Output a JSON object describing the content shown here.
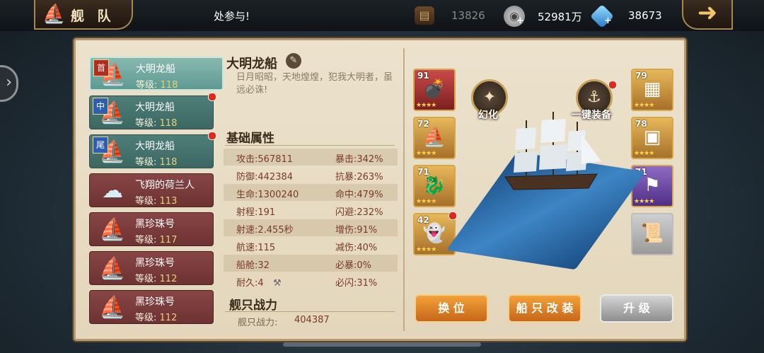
{
  "header": {
    "title": "舰 队",
    "notice": "处参与!",
    "resources": [
      {
        "icon": "coin-chest-icon",
        "value": "13826"
      },
      {
        "icon": "silver-coin-icon",
        "value": "52981万"
      },
      {
        "icon": "diamond-icon",
        "value": "38673"
      }
    ]
  },
  "fleet": [
    {
      "badge": "首",
      "name": "大明龙船",
      "level_label": "等级:",
      "level": "118",
      "style": "selected",
      "dot": false
    },
    {
      "badge": "中",
      "name": "大明龙船",
      "level_label": "等级:",
      "level": "118",
      "style": "green",
      "dot": true
    },
    {
      "badge": "尾",
      "name": "大明龙船",
      "level_label": "等级:",
      "level": "118",
      "style": "green",
      "dot": true
    },
    {
      "badge": "",
      "name": "飞翔的荷兰人",
      "level_label": "等级:",
      "level": "113",
      "style": "red",
      "dot": false
    },
    {
      "badge": "",
      "name": "黑珍珠号",
      "level_label": "等级:",
      "level": "117",
      "style": "red",
      "dot": false
    },
    {
      "badge": "",
      "name": "黑珍珠号",
      "level_label": "等级:",
      "level": "112",
      "style": "red",
      "dot": false
    },
    {
      "badge": "",
      "name": "黑珍珠号",
      "level_label": "等级:",
      "level": "112",
      "style": "red",
      "dot": false
    }
  ],
  "ship": {
    "name": "大明龙船",
    "description": "日月昭昭，天地煌煌，犯我大明者，虽远必诛!",
    "base_attr_title": "基础属性",
    "attributes": [
      [
        "攻击:567811",
        "暴击:342%"
      ],
      [
        "防御:442384",
        "抗暴:263%"
      ],
      [
        "生命:1300240",
        "命中:479%"
      ],
      [
        "射程:191",
        "闪避:232%"
      ],
      [
        "射速:2.455秒",
        "增伤:91%"
      ],
      [
        "航速:115",
        "减伤:40%"
      ],
      [
        "船舱:32",
        "必暴:0%"
      ],
      [
        "耐久:4",
        "必闪:31%"
      ]
    ],
    "power_title": "舰只战力",
    "power_label": "舰只战力:",
    "power_value": "404387"
  },
  "equipment_left": [
    {
      "level": "91",
      "color": "red",
      "icon": "cannon-icon",
      "stars": 4,
      "dot": false
    },
    {
      "level": "72",
      "color": "gold",
      "icon": "sail-icon",
      "stars": 4,
      "dot": false
    },
    {
      "level": "71",
      "color": "gold",
      "icon": "figurehead-icon",
      "stars": 4,
      "dot": false
    },
    {
      "level": "42",
      "color": "gold",
      "icon": "ghost-figurehead-icon",
      "stars": 4,
      "dot": true
    }
  ],
  "equipment_right": [
    {
      "level": "79",
      "color": "gold",
      "icon": "plank-icon",
      "stars": 4,
      "dot": false
    },
    {
      "level": "78",
      "color": "gold",
      "icon": "crate-icon",
      "stars": 4,
      "dot": false
    },
    {
      "level": "71",
      "color": "purple",
      "icon": "flag-icon",
      "stars": 4,
      "dot": false
    },
    {
      "level": "",
      "color": "grey",
      "icon": "scroll-icon",
      "stars": 0,
      "dot": false
    }
  ],
  "model_actions": {
    "transform_label": "幻化",
    "one_key_label": "一键装备"
  },
  "buttons": {
    "swap": "换 位",
    "modify": "船 只 改 装",
    "upgrade": "升 级"
  }
}
